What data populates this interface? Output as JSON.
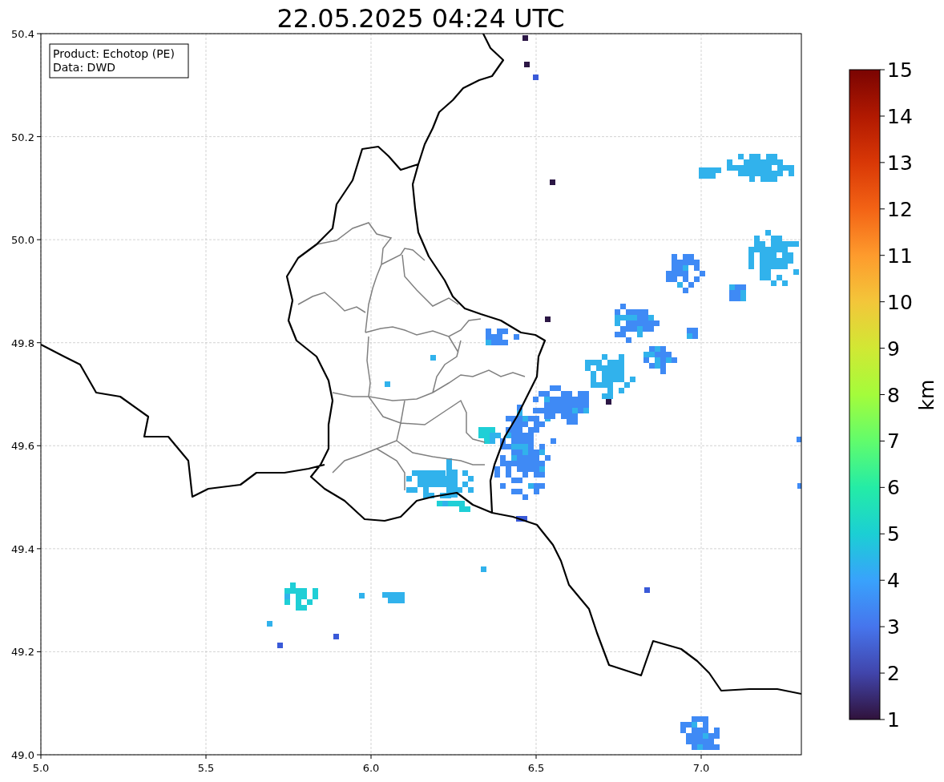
{
  "title": "22.05.2025 04:24 UTC",
  "info_box": [
    "Product: Echotop (PE)",
    "Data: DWD"
  ],
  "x_ticks": [
    "5.0",
    "5.5",
    "6.0",
    "6.5",
    "7.0"
  ],
  "y_ticks": [
    "50.4",
    "50.2",
    "50.0",
    "49.8",
    "49.6",
    "49.4",
    "49.2",
    "49.0"
  ],
  "colorbar": {
    "label": "km",
    "ticks": [
      "15",
      "14",
      "13",
      "12",
      "11",
      "10",
      "9",
      "8",
      "7",
      "6",
      "5",
      "4",
      "3",
      "2",
      "1"
    ]
  }
}
